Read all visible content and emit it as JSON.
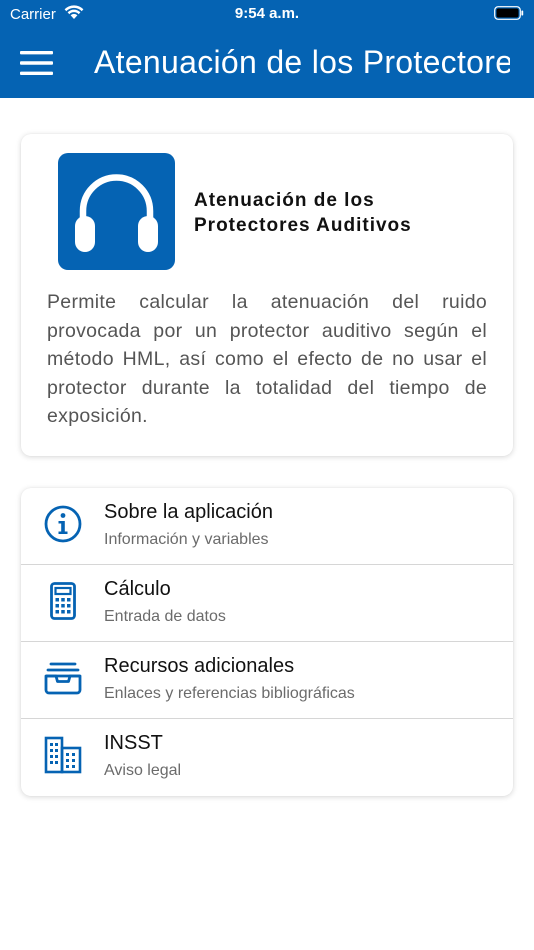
{
  "status_bar": {
    "carrier": "Carrier",
    "time": "9:54 a.m."
  },
  "header": {
    "title": "Atenuación de los Protectores Auditivos",
    "background_color": "#0563b3"
  },
  "hero": {
    "title_line1": "Atenuación de los",
    "title_line2": "Protectores Auditivos",
    "description": "Permite calcular la atenuación del ruido provocada por un protector auditivo según el método HML, así como el efecto de no usar el protector durante la totalidad del tiempo de exposición.",
    "logo_icon": "headphones-icon"
  },
  "menu": {
    "items": [
      {
        "icon": "info-icon",
        "title": "Sobre la aplicación",
        "subtitle": "Información y variables"
      },
      {
        "icon": "calculator-icon",
        "title": "Cálculo",
        "subtitle": "Entrada de datos"
      },
      {
        "icon": "inbox-tray-icon",
        "title": "Recursos adicionales",
        "subtitle": "Enlaces y referencias bibliográficas"
      },
      {
        "icon": "building-icon",
        "title": "INSST",
        "subtitle": "Aviso legal"
      }
    ]
  },
  "colors": {
    "accent": "#0563b3",
    "text_primary": "#111111",
    "text_secondary": "#6b6b6b"
  }
}
